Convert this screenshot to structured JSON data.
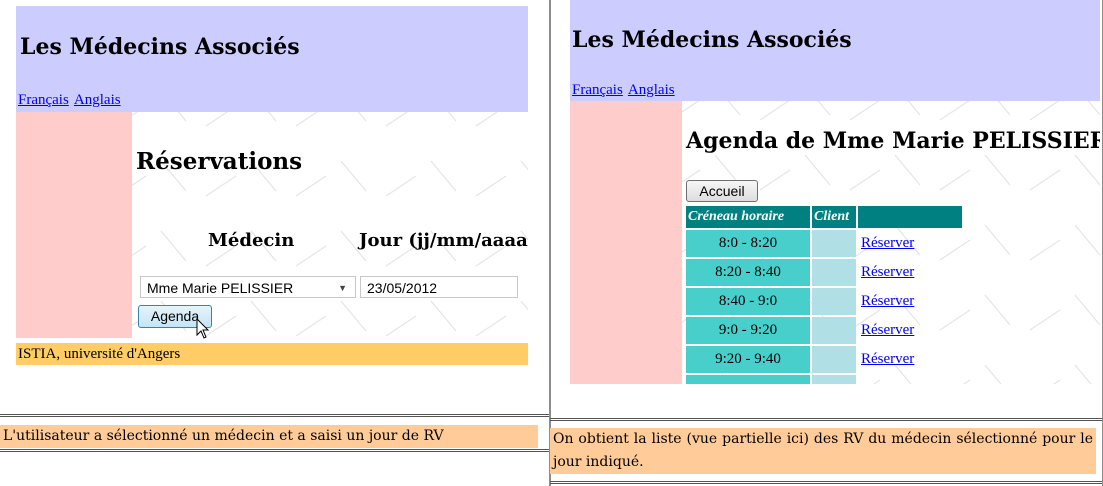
{
  "site_title": "Les Médecins Associés",
  "languages": [
    "Français",
    "Anglais"
  ],
  "left": {
    "page_heading": "Réservations",
    "col_medecin": "Médecin",
    "col_jour": "Jour (jj/mm/aaaa)",
    "doctor_selected": "Mme Marie PELISSIER",
    "date_value": "23/05/2012",
    "agenda_button": "Agenda",
    "footer": "ISTIA, université d'Angers",
    "caption": "L'utilisateur a sélectionné un médecin et a saisi un jour de RV"
  },
  "right": {
    "agenda_title": "Agenda de Mme Marie PELISSIER",
    "home_button": "Accueil",
    "table_headers": [
      "Créneau horaire",
      "Client",
      ""
    ],
    "rows": [
      {
        "slot": "8:0 - 8:20",
        "client": "",
        "action": "Réserver"
      },
      {
        "slot": "8:20 - 8:40",
        "client": "",
        "action": "Réserver"
      },
      {
        "slot": "8:40 - 9:0",
        "client": "",
        "action": "Réserver"
      },
      {
        "slot": "9:0 - 9:20",
        "client": "",
        "action": "Réserver"
      },
      {
        "slot": "9:20 - 9:40",
        "client": "",
        "action": "Réserver"
      }
    ],
    "caption": "On obtient la liste (vue partielle ici) des RV du médecin sélectionné pour le jour indiqué."
  },
  "colors": {
    "header": "#ccccff",
    "sidebar": "#ffcccc",
    "footer": "#ffcc66",
    "caption": "#ffcc99",
    "table_header": "#008080",
    "slot_cell": "#48cfcb",
    "client_cell": "#b0dfe6"
  },
  "icons": [
    "dropdown-arrow-icon",
    "mouse-cursor-icon"
  ]
}
